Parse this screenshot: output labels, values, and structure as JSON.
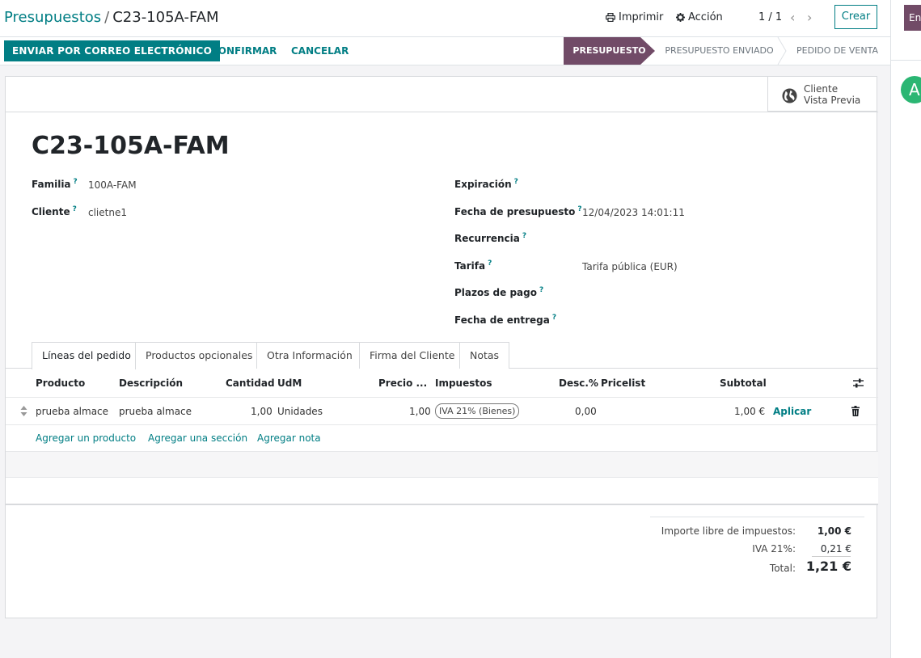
{
  "breadcrumb": {
    "parent": "Presupuestos",
    "separator": "/",
    "current": "C23-105A-FAM"
  },
  "toolbar": {
    "print": "Imprimir",
    "action": "Acción",
    "pager": "1 / 1",
    "create": "Crear"
  },
  "side_panel": {
    "button_label": "En",
    "avatar_letter": "A"
  },
  "actions": {
    "send_email": "ENVIAR POR CORREO ELECTRÓNICO",
    "confirm": "CONFIRMAR",
    "cancel": "CANCELAR"
  },
  "stages": [
    {
      "label": "PRESUPUESTO",
      "active": true
    },
    {
      "label": "PRESUPUESTO ENVIADO",
      "active": false
    },
    {
      "label": "PEDIDO DE VENTA",
      "active": false
    }
  ],
  "preview": {
    "line1": "Cliente",
    "line2": "Vista Previa"
  },
  "record": {
    "title": "C23-105A-FAM"
  },
  "fields_left": [
    {
      "label": "Familia",
      "value": "100A-FAM"
    },
    {
      "label": "Cliente",
      "value": "clietne1"
    }
  ],
  "fields_right": [
    {
      "label": "Expiración",
      "value": ""
    },
    {
      "label": "Fecha de presupuesto",
      "value": "12/04/2023 14:01:11"
    },
    {
      "label": "Recurrencia",
      "value": ""
    },
    {
      "label": "Tarifa",
      "value": "Tarifa pública (EUR)"
    },
    {
      "label": "Plazos de pago",
      "value": ""
    },
    {
      "label": "Fecha de entrega",
      "value": ""
    }
  ],
  "help_marker": "?",
  "tabs": [
    {
      "label": "Líneas del pedido",
      "active": true
    },
    {
      "label": "Productos opcionales",
      "active": false
    },
    {
      "label": "Otra Información",
      "active": false
    },
    {
      "label": "Firma del Cliente",
      "active": false
    },
    {
      "label": "Notas",
      "active": false
    }
  ],
  "lines": {
    "columns": [
      "Producto",
      "Descripción",
      "Cantidad",
      "UdM",
      "Precio ...",
      "Impuestos",
      "Desc.%",
      "Pricelist",
      "Subtotal"
    ],
    "rows": [
      {
        "product": "prueba almace",
        "description": "prueba almace",
        "quantity": "1,00",
        "uom": "Unidades",
        "price": "1,00",
        "tax": "IVA 21% (Bienes)",
        "discount": "0,00",
        "pricelist": "",
        "subtotal": "1,00 €",
        "apply": "Aplicar"
      }
    ],
    "add_product": "Agregar un producto",
    "add_section": "Agregar una sección",
    "add_note": "Agregar nota"
  },
  "totals": {
    "untaxed_label": "Importe libre de impuestos:",
    "untaxed_value": "1,00 €",
    "tax_label": "IVA 21%:",
    "tax_value": "0,21 €",
    "total_label": "Total:",
    "total_value": "1,21 €"
  },
  "colors": {
    "primary": "#017e84",
    "stage_active": "#714b67",
    "avatar": "#2bb673"
  }
}
